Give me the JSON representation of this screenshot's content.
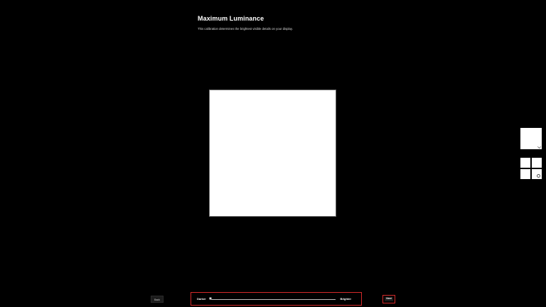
{
  "page": {
    "title": "Maximum Luminance",
    "subtitle": "This calibration determines the brightest visible details on your display."
  },
  "slider": {
    "min_label": "Darker",
    "max_label": "Brighter",
    "value_fraction": 0.0
  },
  "buttons": {
    "back_label": "Back",
    "next_label": "Next"
  },
  "colors": {
    "background": "#000000",
    "test_pattern": "#ffffff",
    "highlight": "#d42a2a"
  },
  "icons": {
    "swatch_1": "check-icon",
    "swatch_2": "circle-icon"
  }
}
